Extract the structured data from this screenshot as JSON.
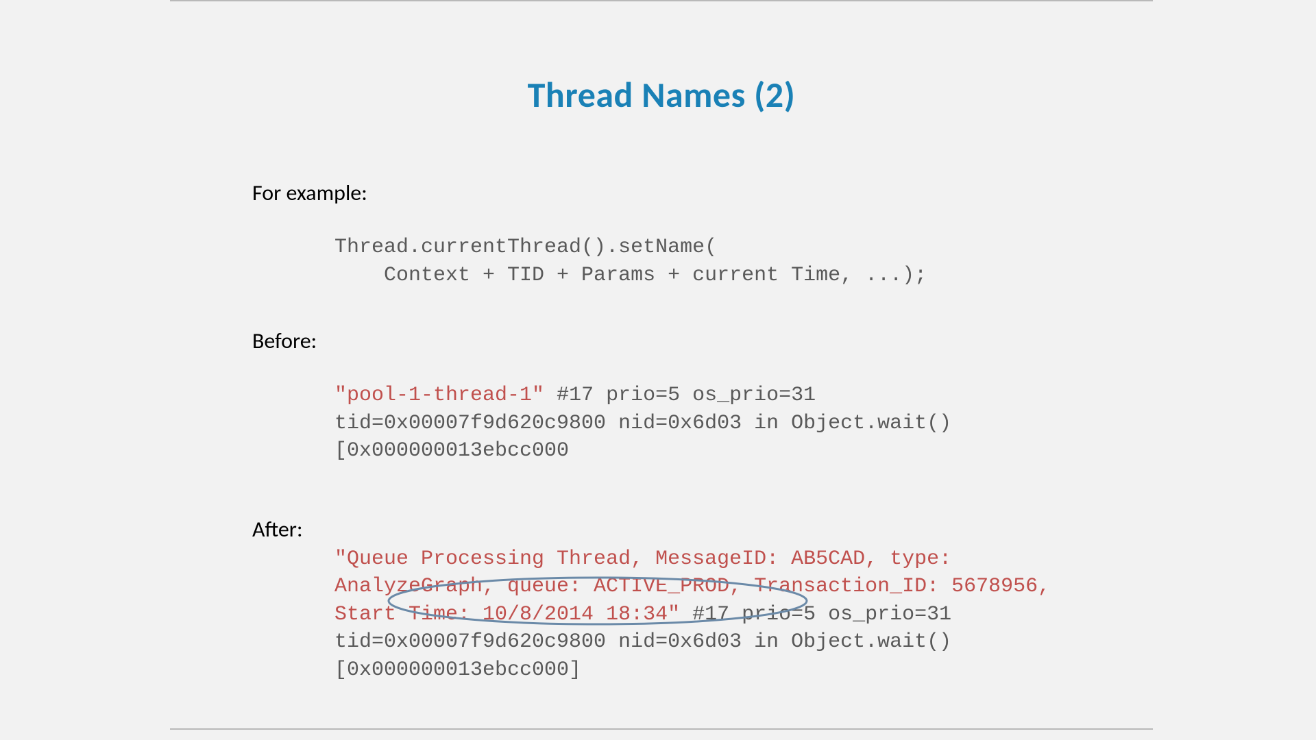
{
  "title": "Thread Names (2)",
  "labels": {
    "for_example": "For example:",
    "before": "Before:",
    "after": "After:"
  },
  "code": {
    "example_line1": "Thread.currentThread().setName(",
    "example_line2": "    Context + TID + Params + current Time, ...);",
    "before_name": "\"pool-1-thread-1\"",
    "before_rest_line1": " #17 prio=5 os_prio=31",
    "before_line2": "tid=0x00007f9d620c9800 nid=0x6d03 in Object.wait()",
    "before_line3": "[0x000000013ebcc000",
    "after_name_line1": "\"Queue Processing Thread, MessageID: AB5CAD, type:",
    "after_name_line2": "AnalyzeGraph, queue: ACTIVE_PROD, Transaction_ID: 5678956,",
    "after_name_line3": "Start Time: 10/8/2014 18:34\"",
    "after_rest_line3": " #17 prio=5 os_prio=31",
    "after_line4": "tid=0x00007f9d620c9800 nid=0x6d03 in Object.wait()",
    "after_line5": "[0x000000013ebcc000]"
  }
}
